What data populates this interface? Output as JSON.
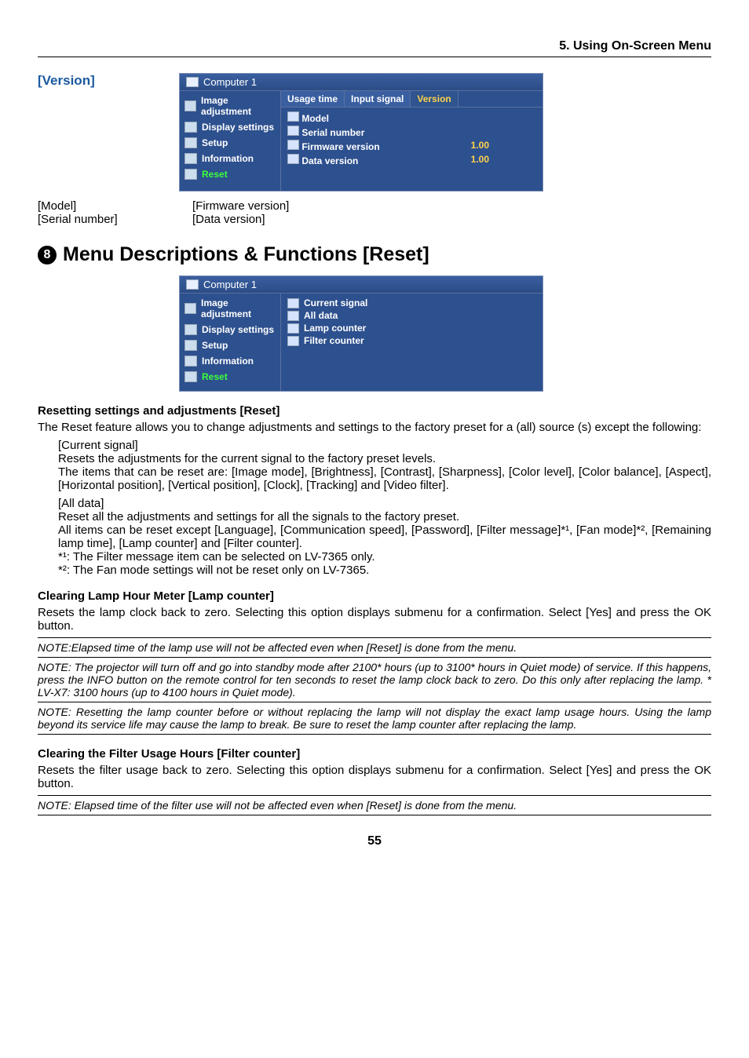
{
  "header": {
    "chapter": "5. Using On-Screen Menu"
  },
  "version": {
    "heading": "[Version]",
    "osd_title": "Computer 1",
    "sidebar": [
      "Image adjustment",
      "Display settings",
      "Setup",
      "Information",
      "Reset"
    ],
    "tabs": [
      "Usage time",
      "Input signal",
      "Version"
    ],
    "rows": {
      "model": {
        "label": "Model",
        "value": ""
      },
      "serial": {
        "label": "Serial number",
        "value": ""
      },
      "firmware": {
        "label": "Firmware version",
        "value": "1.00"
      },
      "data": {
        "label": "Data version",
        "value": "1.00"
      }
    },
    "legend": {
      "col1a": "[Model]",
      "col1b": "[Serial number]",
      "col2a": "[Firmware version]",
      "col2b": "[Data version]"
    }
  },
  "reset": {
    "heading": "Menu Descriptions & Functions [Reset]",
    "circle": "8",
    "osd_title": "Computer 1",
    "sidebar": [
      "Image adjustment",
      "Display settings",
      "Setup",
      "Information",
      "Reset"
    ],
    "items": [
      "Current signal",
      "All data",
      "Lamp counter",
      "Filter counter"
    ],
    "h1": "Resetting settings and adjustments [Reset]",
    "p1": "The Reset feature allows you to change adjustments and settings to the factory preset for a (all) source (s) except the following:",
    "cs_label": "[Current signal]",
    "cs_p1": "Resets the adjustments for the current signal to the factory preset levels.",
    "cs_p2": "The items that can be reset are: [Image mode], [Brightness], [Contrast], [Sharpness], [Color level], [Color balance],  [Aspect],  [Horizontal position], [Vertical position], [Clock], [Tracking] and [Video filter].",
    "ad_label": "[All data]",
    "ad_p1": "Reset all the adjustments and settings for all the signals to the factory preset.",
    "ad_p2": "All items can be reset except [Language], [Communication speed], [Password], [Filter message]*¹, [Fan mode]*², [Remaining lamp time], [Lamp counter] and [Filter counter].",
    "ad_n1": "*¹: The Filter message item can be selected on LV-7365 only.",
    "ad_n2": "*²: The Fan mode settings will not be reset only on LV-7365.",
    "h2": "Clearing Lamp Hour Meter [Lamp counter]",
    "p2": "Resets the lamp clock back to zero. Selecting this option displays submenu for a confirmation. Select [Yes] and press the OK button.",
    "note1": "NOTE:Elapsed time of the lamp use will not be affected even when [Reset] is done from the menu.",
    "note2": "NOTE: The projector will turn off and go into standby mode after 2100* hours (up to 3100* hours in Quiet mode) of service. If this happens, press the INFO button on the remote control for ten seconds to reset the lamp clock back to zero. Do this only after replacing the lamp. * LV-X7: 3100 hours (up to 4100 hours in Quiet mode).",
    "note3": "NOTE: Resetting the lamp counter before or without replacing the lamp will not display the exact lamp usage hours. Using the lamp beyond its service life may cause the lamp to break. Be sure to reset the lamp counter after replacing the lamp.",
    "h3": "Clearing the Filter Usage Hours [Filter counter]",
    "p3": "Resets the filter usage back to zero. Selecting this option displays submenu for a confirmation. Select [Yes] and press the OK button.",
    "note4": "NOTE: Elapsed time of the filter use will not be affected even when [Reset] is done from the menu."
  },
  "page_number": "55"
}
